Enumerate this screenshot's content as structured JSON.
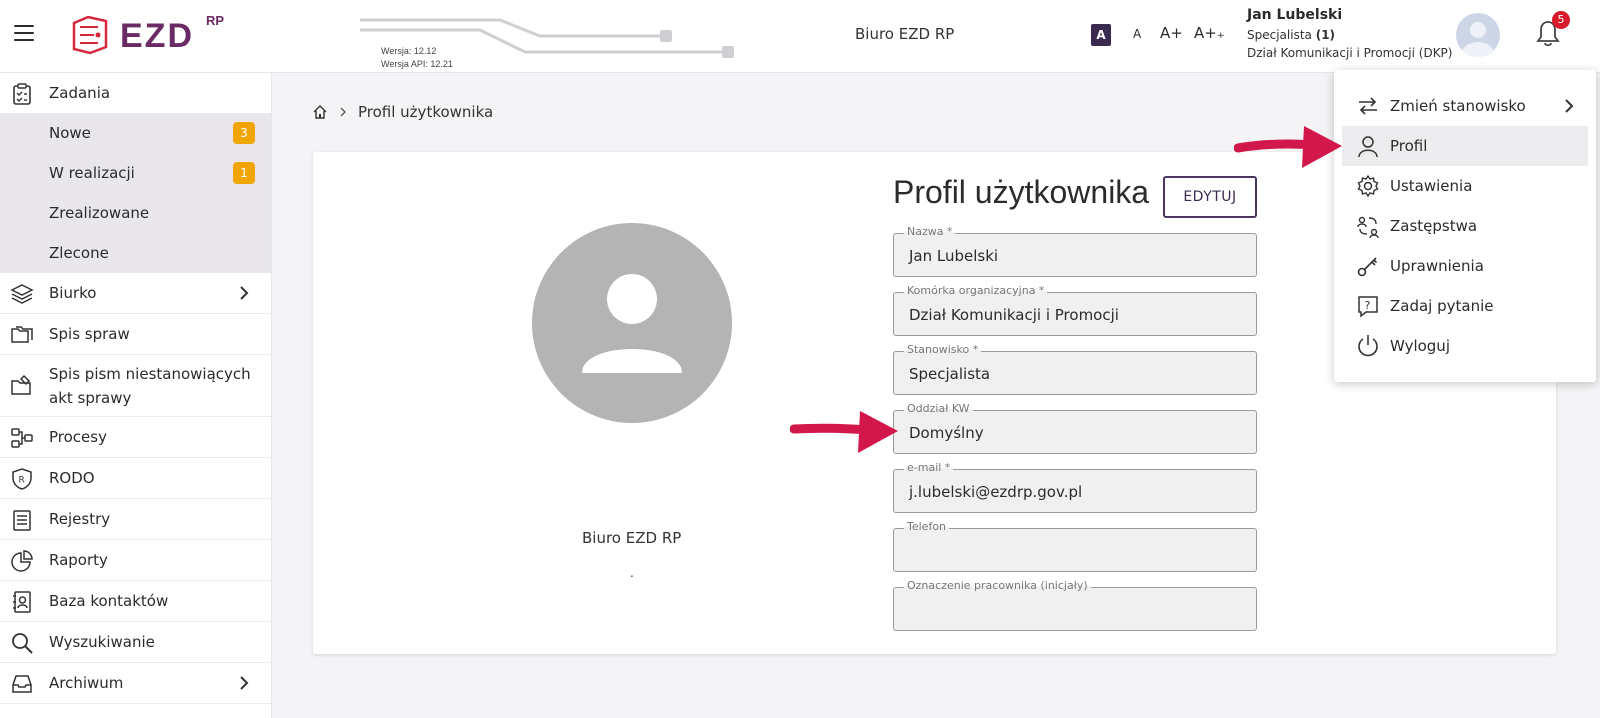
{
  "header": {
    "logo_text": "EZD",
    "logo_superscript": "RP",
    "version": "Wersja: 12.12",
    "api_version": "Wersja API: 12.21",
    "office_name": "Biuro EZD RP",
    "font_sizes": [
      "A",
      "A",
      "A+",
      "A+₊"
    ],
    "user": {
      "name": "Jan Lubelski",
      "position_prefix": "Specjalista ",
      "position_count": "(1)",
      "department": "Dział Komunikacji i Promocji (DKP)"
    },
    "notifications_count": "5"
  },
  "sidebar": {
    "tasks_label": "Zadania",
    "subitems": [
      {
        "label": "Nowe",
        "badge": "3"
      },
      {
        "label": "W realizacji",
        "badge": "1"
      },
      {
        "label": "Zrealizowane"
      },
      {
        "label": "Zlecone"
      }
    ],
    "items": [
      {
        "label": "Biurko",
        "icon": "layers-icon",
        "has_chevron": true
      },
      {
        "label": "Spis spraw",
        "icon": "folders-icon"
      },
      {
        "label_line1": "Spis pism niestanowiących",
        "label_line2": "akt sprawy",
        "icon": "folder-edit-icon"
      },
      {
        "label": "Procesy",
        "icon": "process-icon"
      },
      {
        "label": "RODO",
        "icon": "shield-icon"
      },
      {
        "label": "Rejestry",
        "icon": "register-icon"
      },
      {
        "label": "Raporty",
        "icon": "pie-chart-icon"
      },
      {
        "label": "Baza kontaktów",
        "icon": "contacts-icon"
      },
      {
        "label": "Wyszukiwanie",
        "icon": "search-icon"
      },
      {
        "label": "Archiwum",
        "icon": "archive-icon",
        "has_chevron": true
      }
    ]
  },
  "breadcrumb": {
    "current": "Profil użytkownika"
  },
  "profile": {
    "title": "Profil użytkownika",
    "edit_label": "EDYTUJ",
    "office_name": "Biuro EZD RP",
    "dot": ".",
    "fields": [
      {
        "label": "Nazwa *",
        "value": "Jan Lubelski"
      },
      {
        "label": "Komórka organizacyjna *",
        "value": "Dział Komunikacji i Promocji"
      },
      {
        "label": "Stanowisko *",
        "value": "Specjalista"
      },
      {
        "label": "Oddział KW",
        "value": "Domyślny"
      },
      {
        "label": "e-mail *",
        "value": "j.lubelski@ezdrp.gov.pl"
      },
      {
        "label": "Telefon",
        "value": ""
      },
      {
        "label": "Oznaczenie pracownika (inicjały)",
        "value": ""
      }
    ]
  },
  "menu": {
    "items": [
      {
        "label": "Zmień stanowisko",
        "icon": "swap-icon"
      },
      {
        "label": "Profil",
        "icon": "user-icon"
      },
      {
        "label": "Ustawienia",
        "icon": "gear-icon"
      },
      {
        "label": "Zastępstwa",
        "icon": "substitution-icon"
      },
      {
        "label": "Uprawnienia",
        "icon": "key-icon"
      },
      {
        "label": "Zadaj pytanie",
        "icon": "question-icon"
      },
      {
        "label": "Wyloguj",
        "icon": "power-icon"
      }
    ]
  },
  "colors": {
    "brand": "#6a2a64",
    "accent_dark": "#3b2a4f",
    "badge": "#f2a400",
    "notification": "#d71b2b",
    "arrow": "#d2174a"
  }
}
